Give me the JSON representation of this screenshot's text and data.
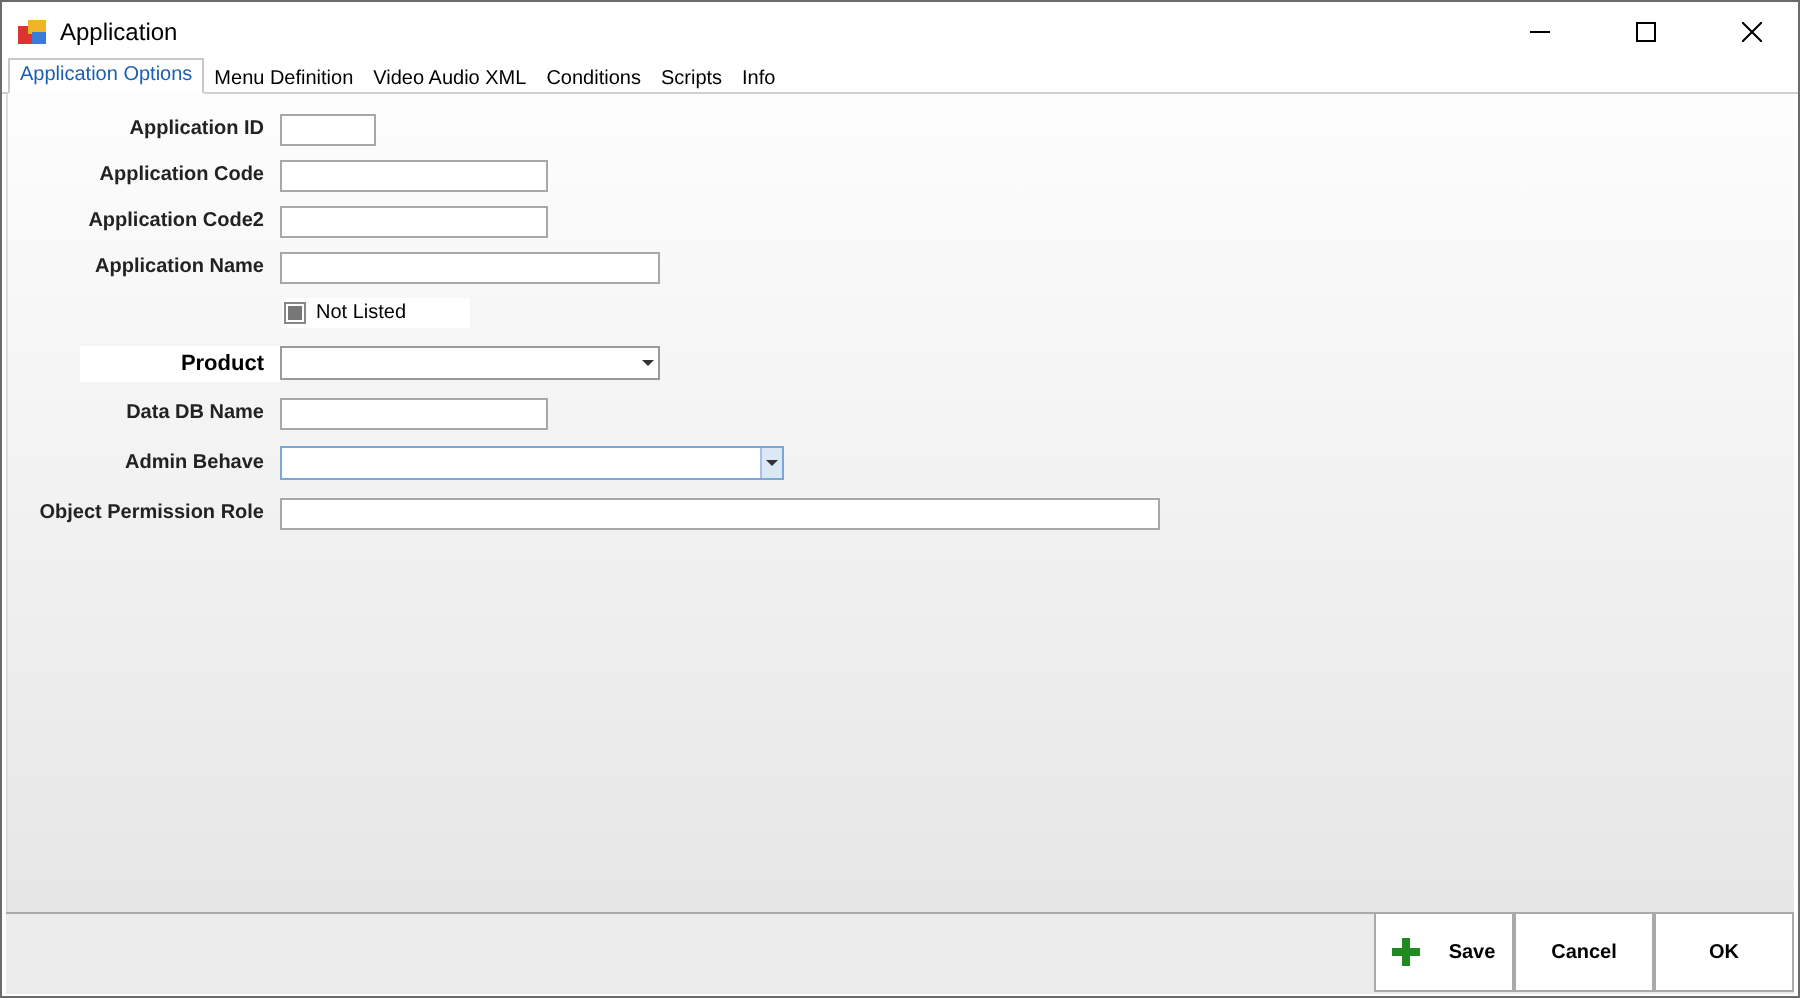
{
  "window": {
    "title": "Application"
  },
  "tabs": [
    {
      "label": "Application Options",
      "selected": true
    },
    {
      "label": "Menu Definition",
      "selected": false
    },
    {
      "label": "Video Audio XML",
      "selected": false
    },
    {
      "label": "Conditions",
      "selected": false
    },
    {
      "label": "Scripts",
      "selected": false
    },
    {
      "label": "Info",
      "selected": false
    }
  ],
  "fields": [
    {
      "kind": "text",
      "label": "Application ID",
      "focused": false
    },
    {
      "kind": "text",
      "label": "Application Code",
      "focused": false
    },
    {
      "kind": "text",
      "label": "Application Code2",
      "focused": false
    },
    {
      "kind": "text",
      "label": "Application Name",
      "focused": false
    },
    {
      "kind": "checkbox",
      "label": "Not Listed",
      "checked": true
    },
    {
      "kind": "combo",
      "label": "Product",
      "focused": false
    },
    {
      "kind": "text",
      "label": "Data DB Name",
      "focused": false
    },
    {
      "kind": "combo",
      "label": "Admin Behave",
      "focused": true
    },
    {
      "kind": "text",
      "label": "Object Permission Role",
      "focused": false
    }
  ],
  "buttons": [
    {
      "kind": "add",
      "label": "Save"
    },
    {
      "kind": "plain",
      "label": "Cancel"
    },
    {
      "kind": "plain",
      "label": "OK"
    }
  ]
}
